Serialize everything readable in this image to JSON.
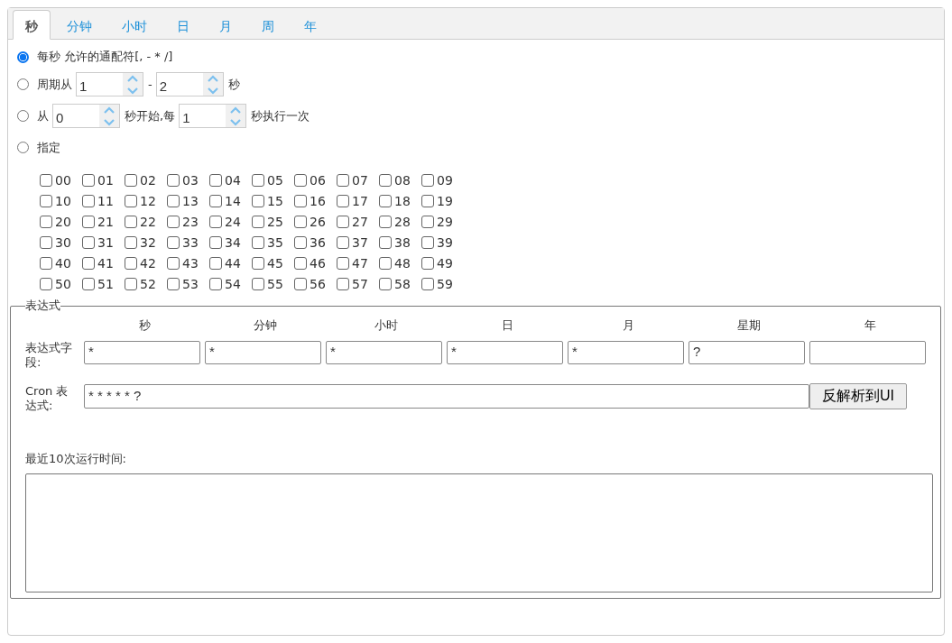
{
  "tabs": [
    {
      "label": "秒",
      "selected": true
    },
    {
      "label": "分钟",
      "selected": false
    },
    {
      "label": "小时",
      "selected": false
    },
    {
      "label": "日",
      "selected": false
    },
    {
      "label": "月",
      "selected": false
    },
    {
      "label": "周",
      "selected": false
    },
    {
      "label": "年",
      "selected": false
    }
  ],
  "options": [
    {
      "selected": true,
      "segments": [
        {
          "kind": "text",
          "text": "每秒 允许的通配符[, - * /]"
        }
      ]
    },
    {
      "selected": false,
      "segments": [
        {
          "kind": "text",
          "text": "周期从"
        },
        {
          "kind": "spin",
          "value": "1"
        },
        {
          "kind": "text",
          "text": "-"
        },
        {
          "kind": "spin",
          "value": "2"
        },
        {
          "kind": "text",
          "text": "秒"
        }
      ]
    },
    {
      "selected": false,
      "segments": [
        {
          "kind": "text",
          "text": "从"
        },
        {
          "kind": "spin",
          "value": "0"
        },
        {
          "kind": "text",
          "text": "秒开始,每"
        },
        {
          "kind": "spin",
          "value": "1"
        },
        {
          "kind": "text",
          "text": "秒执行一次"
        }
      ]
    },
    {
      "selected": false,
      "segments": [
        {
          "kind": "text",
          "text": "指定"
        }
      ]
    }
  ],
  "checkboxes": [
    {
      "label": "00",
      "checked": false
    },
    {
      "label": "01",
      "checked": false
    },
    {
      "label": "02",
      "checked": false
    },
    {
      "label": "03",
      "checked": false
    },
    {
      "label": "04",
      "checked": false
    },
    {
      "label": "05",
      "checked": false
    },
    {
      "label": "06",
      "checked": false
    },
    {
      "label": "07",
      "checked": false
    },
    {
      "label": "08",
      "checked": false
    },
    {
      "label": "09",
      "checked": false
    },
    {
      "label": "10",
      "checked": false
    },
    {
      "label": "11",
      "checked": false
    },
    {
      "label": "12",
      "checked": false
    },
    {
      "label": "13",
      "checked": false
    },
    {
      "label": "14",
      "checked": false
    },
    {
      "label": "15",
      "checked": false
    },
    {
      "label": "16",
      "checked": false
    },
    {
      "label": "17",
      "checked": false
    },
    {
      "label": "18",
      "checked": false
    },
    {
      "label": "19",
      "checked": false
    },
    {
      "label": "20",
      "checked": false
    },
    {
      "label": "21",
      "checked": false
    },
    {
      "label": "22",
      "checked": false
    },
    {
      "label": "23",
      "checked": false
    },
    {
      "label": "24",
      "checked": false
    },
    {
      "label": "25",
      "checked": false
    },
    {
      "label": "26",
      "checked": false
    },
    {
      "label": "27",
      "checked": false
    },
    {
      "label": "28",
      "checked": false
    },
    {
      "label": "29",
      "checked": false
    },
    {
      "label": "30",
      "checked": false
    },
    {
      "label": "31",
      "checked": false
    },
    {
      "label": "32",
      "checked": false
    },
    {
      "label": "33",
      "checked": false
    },
    {
      "label": "34",
      "checked": false
    },
    {
      "label": "35",
      "checked": false
    },
    {
      "label": "36",
      "checked": false
    },
    {
      "label": "37",
      "checked": false
    },
    {
      "label": "38",
      "checked": false
    },
    {
      "label": "39",
      "checked": false
    },
    {
      "label": "40",
      "checked": false
    },
    {
      "label": "41",
      "checked": false
    },
    {
      "label": "42",
      "checked": false
    },
    {
      "label": "43",
      "checked": false
    },
    {
      "label": "44",
      "checked": false
    },
    {
      "label": "45",
      "checked": false
    },
    {
      "label": "46",
      "checked": false
    },
    {
      "label": "47",
      "checked": false
    },
    {
      "label": "48",
      "checked": false
    },
    {
      "label": "49",
      "checked": false
    },
    {
      "label": "50",
      "checked": false
    },
    {
      "label": "51",
      "checked": false
    },
    {
      "label": "52",
      "checked": false
    },
    {
      "label": "53",
      "checked": false
    },
    {
      "label": "54",
      "checked": false
    },
    {
      "label": "55",
      "checked": false
    },
    {
      "label": "56",
      "checked": false
    },
    {
      "label": "57",
      "checked": false
    },
    {
      "label": "58",
      "checked": false
    },
    {
      "label": "59",
      "checked": false
    }
  ],
  "expression": {
    "legend": "表达式",
    "columns": [
      "秒",
      "分钟",
      "小时",
      "日",
      "月",
      "星期",
      "年"
    ],
    "field_label": "表达式字段:",
    "fields": [
      {
        "kind": "filled",
        "value": "*"
      },
      {
        "kind": "filled",
        "value": "*"
      },
      {
        "kind": "filled",
        "value": "*"
      },
      {
        "kind": "filled",
        "value": "*"
      },
      {
        "kind": "filled",
        "value": "*"
      },
      {
        "kind": "filled",
        "value": "?"
      },
      {
        "kind": "blank"
      }
    ],
    "cron_label": "Cron 表达式:",
    "cron_value": "* * * * * ?",
    "parse_button": "反解析到UI",
    "recent_label": "最近10次运行时间:"
  }
}
